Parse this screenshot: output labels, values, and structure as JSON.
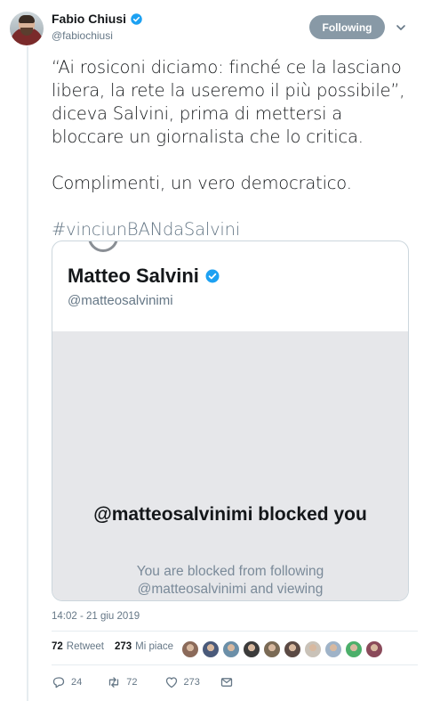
{
  "author": {
    "display_name": "Fabio Chiusi",
    "handle": "@fabiochiusi",
    "follow_label": "Following"
  },
  "tweet": {
    "paragraph1": "“Ai rosiconi diciamo: finché ce la lasciano libera, la rete la useremo il più possibile”, diceva Salvini, prima di mettersi a bloccare un giornalista che lo critica.",
    "paragraph2": "Complimenti, un vero democratico.",
    "hashtag": "#vinciunBANdaSalvini"
  },
  "embedded": {
    "name": "Matteo Salvini",
    "handle": "@matteosalvinimi",
    "blocked_title": "@matteosalvinimi blocked you",
    "blocked_line1": "You are blocked from following",
    "blocked_line2": "@matteosalvinimi and viewing"
  },
  "timestamp": "14:02 - 21 giu 2019",
  "stats": {
    "retweets_count": "72",
    "retweets_label": "Retweet",
    "likes_count": "273",
    "likes_label": "Mi piace"
  },
  "actions": {
    "replies": "24",
    "retweets": "72",
    "likes": "273"
  },
  "colors": {
    "verified_blue": "#1da1f2",
    "follow_button_bg": "#8899a6",
    "secondary_text": "#657786"
  },
  "likers": [
    {
      "color": "#8b6a5a"
    },
    {
      "color": "#4a5a7a"
    },
    {
      "color": "#6b8fa8"
    },
    {
      "color": "#3b3b3b"
    },
    {
      "color": "#7a6a55"
    },
    {
      "color": "#5b4a44"
    },
    {
      "color": "#c9c2b8"
    },
    {
      "color": "#9fb3c8"
    },
    {
      "color": "#4caf6a"
    },
    {
      "color": "#8a4a5a"
    }
  ]
}
